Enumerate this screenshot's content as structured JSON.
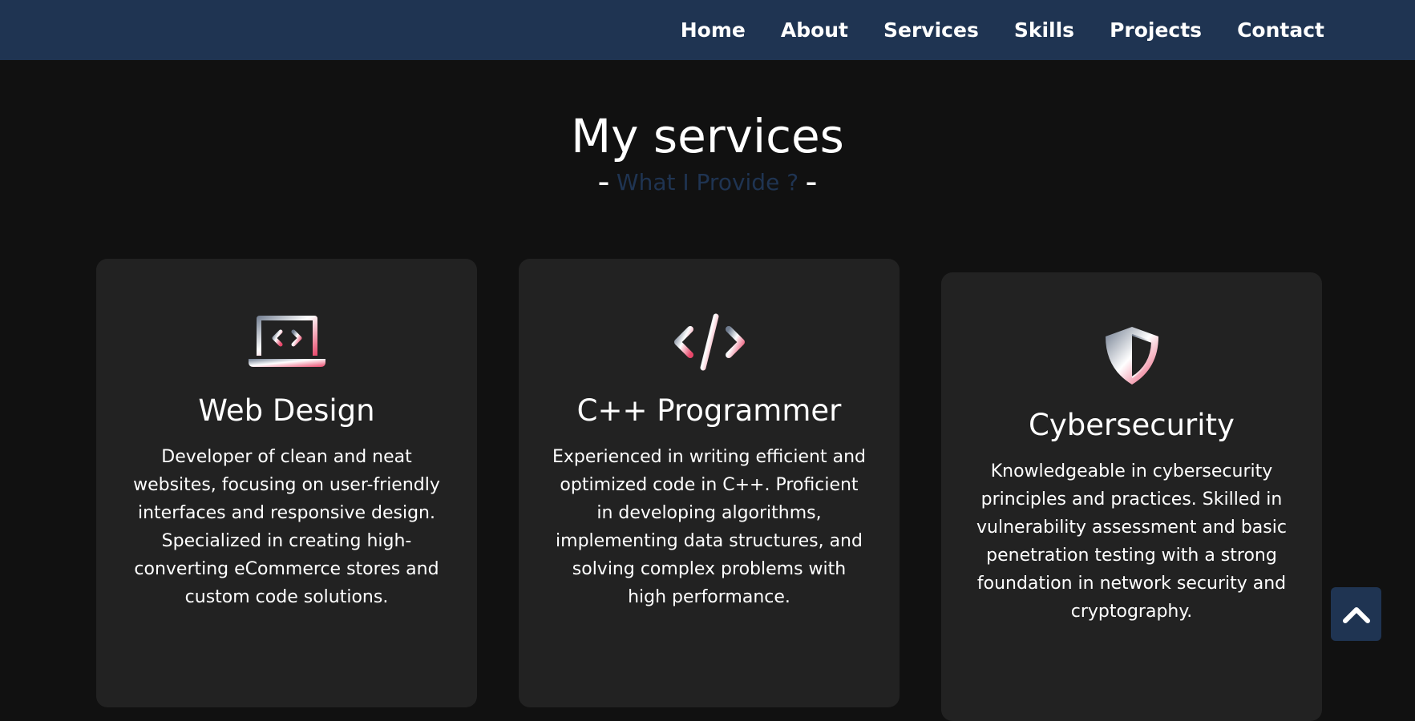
{
  "nav": {
    "items": [
      {
        "label": "Home"
      },
      {
        "label": "About"
      },
      {
        "label": "Services"
      },
      {
        "label": "Skills"
      },
      {
        "label": "Projects"
      },
      {
        "label": "Contact"
      }
    ]
  },
  "section": {
    "title": "My services",
    "subtitle_dash_left": "–",
    "subtitle": "What I Provide ?",
    "subtitle_dash_right": "–"
  },
  "services": [
    {
      "icon": "laptop-code-icon",
      "title": "Web Design",
      "description": "Developer of clean and neat websites, focusing on user-friendly interfaces and responsive design. Specialized in creating high-converting eCommerce stores and custom code solutions."
    },
    {
      "icon": "code-icon",
      "title": "C++ Programmer",
      "description": "Experienced in writing efficient and optimized code in C++. Proficient in developing algorithms, implementing data structures, and solving complex problems with high performance."
    },
    {
      "icon": "shield-icon",
      "title": "Cybersecurity",
      "description": "Knowledgeable in cybersecurity principles and practices. Skilled in vulnerability assessment and basic penetration testing with a strong foundation in network security and cryptography."
    }
  ],
  "scroll_top": {
    "icon": "chevron-up-icon"
  },
  "colors": {
    "navbar": "#1f3452",
    "background": "#111111",
    "card": "#222222",
    "accent_pink": "#e8476a",
    "subtitle_text": "#1f3452"
  }
}
